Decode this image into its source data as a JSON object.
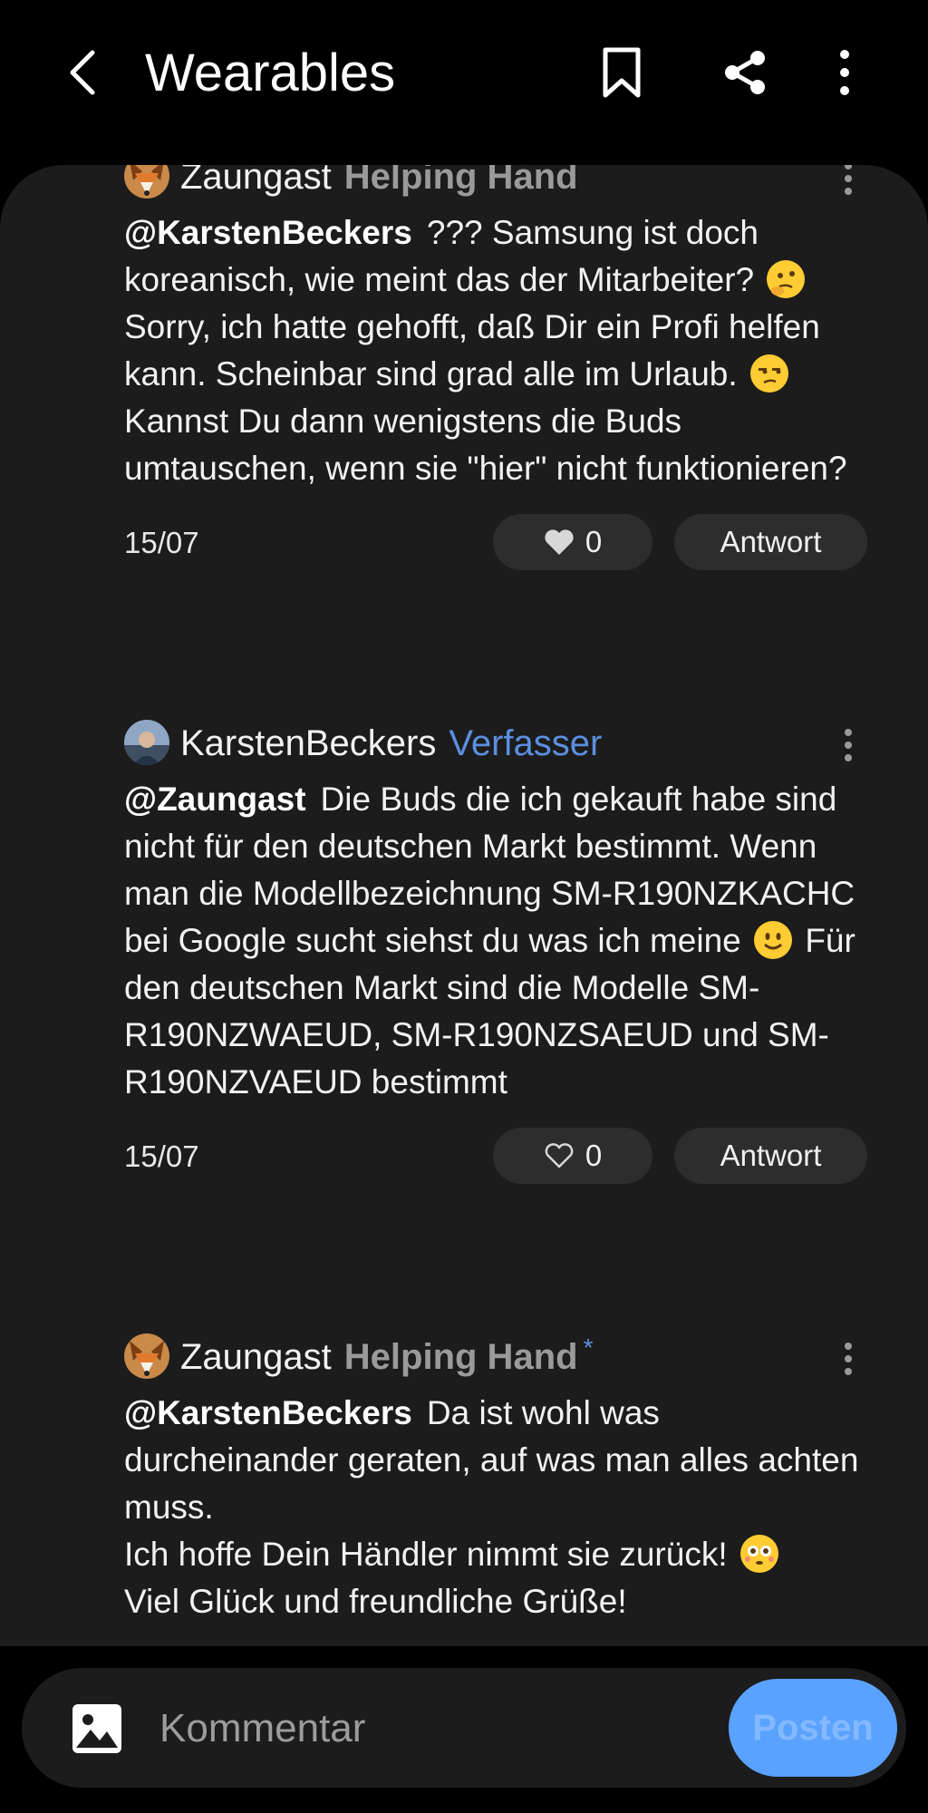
{
  "header": {
    "title": "Wearables",
    "icons": [
      "back-arrow-icon",
      "bookmark-icon",
      "share-icon",
      "more-vertical-icon"
    ]
  },
  "posts": [
    {
      "author": "Zaungast",
      "badge": "Helping Hand",
      "mention": "@KarstenBeckers",
      "text_parts": [
        "??? Samsung ist doch koreanisch, wie meint das der Mitarbeiter?",
        "Sorry, ich hatte gehofft, daß Dir ein Profi helfen kann. Scheinbar sind grad alle im Urlaub.",
        "Kannst Du dann wenigstens die Buds umtauschen, wenn sie \"hier\" nicht funktionieren?"
      ],
      "date": "15/07",
      "likes": "0",
      "liked": true,
      "reply_label": "Antwort"
    },
    {
      "author": "KarstenBeckers",
      "badge": "Verfasser",
      "mention": "@Zaungast",
      "text_parts": [
        "Die Buds die ich gekauft habe sind nicht für den deutschen Markt bestimmt. Wenn man die Modellbezeichnung SM-R190NZKACHC bei Google sucht siehst du was ich meine",
        "Für den deutschen Markt sind die Modelle SM-R190NZWAEUD, SM-R190NZSAEUD und SM-R190NZVAEUD bestimmt"
      ],
      "date": "15/07",
      "likes": "0",
      "liked": false,
      "reply_label": "Antwort"
    },
    {
      "author": "Zaungast",
      "badge": "Helping Hand",
      "badge_mark": "*",
      "mention": "@KarstenBeckers",
      "text_parts": [
        "Da ist wohl was durcheinander geraten, auf was man alles achten muss.",
        "Ich hoffe Dein Händler nimmt sie zurück!",
        "Viel Glück und freundliche Grüße!"
      ]
    }
  ],
  "composer": {
    "placeholder": "Kommentar",
    "post_label": "Posten"
  },
  "colors": {
    "background": "#000000",
    "panel": "#1c1c1c",
    "accent_blue": "#5b8fe0",
    "post_button": "#5aa2ff"
  }
}
